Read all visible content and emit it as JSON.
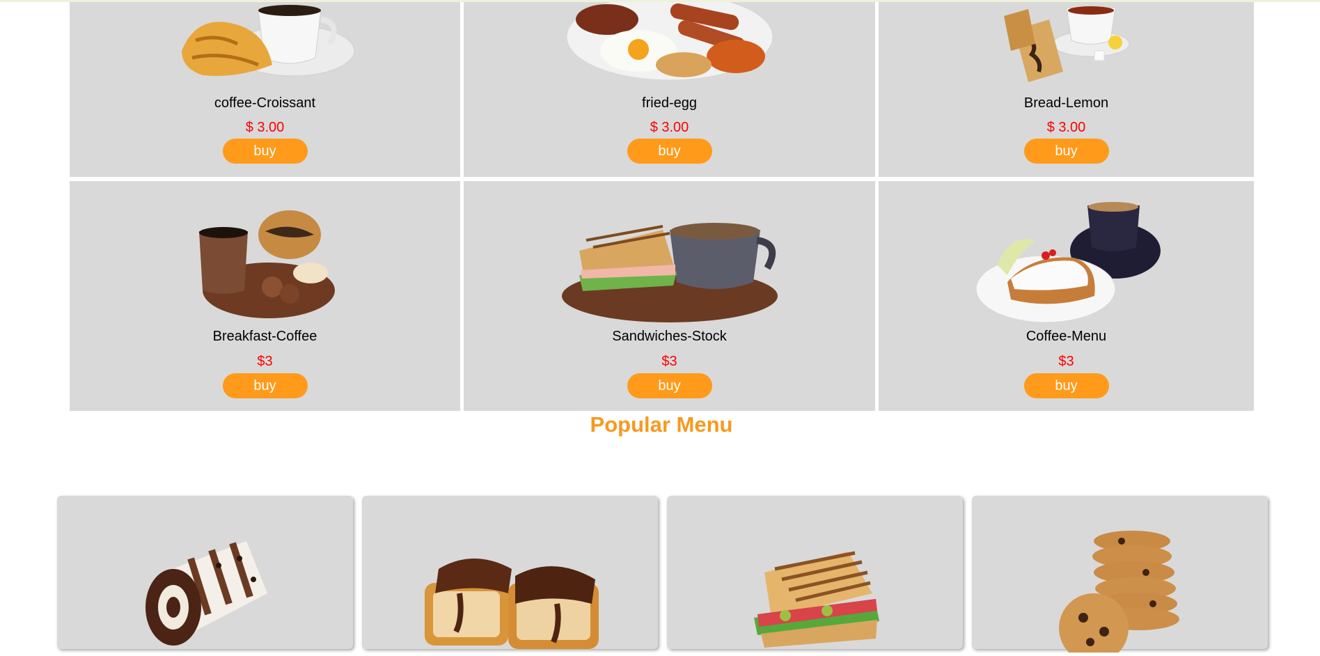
{
  "menu_items": [
    {
      "name": "coffee-Croissant",
      "price": "$ 3.00",
      "buy_label": "buy",
      "image": "coffee-croissant-image"
    },
    {
      "name": "fried-egg",
      "price": "$ 3.00",
      "buy_label": "buy",
      "image": "fried-egg-breakfast-image"
    },
    {
      "name": "Bread-Lemon",
      "price": "$ 3.00",
      "buy_label": "buy",
      "image": "bread-lemon-tea-image"
    },
    {
      "name": "Breakfast-Coffee",
      "price": "$3",
      "buy_label": "buy",
      "image": "breakfast-coffee-image"
    },
    {
      "name": "Sandwiches-Stock",
      "price": "$3",
      "buy_label": "buy",
      "image": "sandwich-coffee-image"
    },
    {
      "name": "Coffee-Menu",
      "price": "$3",
      "buy_label": "buy",
      "image": "strudel-coffee-image"
    }
  ],
  "popular": {
    "title": "Popular Menu",
    "items": [
      "chocolate-roll-cake-image",
      "chocolate-bread-image",
      "grilled-sandwich-image",
      "cookie-stack-image"
    ]
  },
  "colors": {
    "accent": "#f7991f",
    "button": "#ff9a1a",
    "price": "#ff0000",
    "card": "#d9d9d9"
  }
}
